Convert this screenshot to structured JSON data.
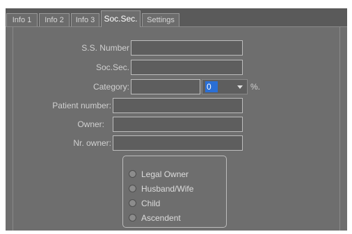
{
  "tabs": [
    {
      "label": "Info 1"
    },
    {
      "label": "Info 2"
    },
    {
      "label": "Info 3"
    },
    {
      "label": "Soc.Sec."
    },
    {
      "label": "Settings"
    }
  ],
  "form": {
    "ss_number": {
      "label": "S.S. Number",
      "value": ""
    },
    "socsec": {
      "label": "Soc.Sec.",
      "value": ""
    },
    "category": {
      "label": "Category:",
      "value": "",
      "select_value": "0",
      "unit": "%."
    },
    "patient_number": {
      "label": "Patient number:",
      "value": ""
    },
    "owner": {
      "label": "Owner:",
      "value": ""
    },
    "nr_owner": {
      "label": "Nr. owner:",
      "value": ""
    }
  },
  "owner_type": {
    "options": [
      {
        "label": "Legal Owner"
      },
      {
        "label": "Husband/Wife"
      },
      {
        "label": "Child"
      },
      {
        "label": "Ascendent"
      }
    ]
  },
  "colors": {
    "panel": "#6e6e6e",
    "field_border": "#bdbdbd",
    "selection": "#2a6fd6"
  }
}
